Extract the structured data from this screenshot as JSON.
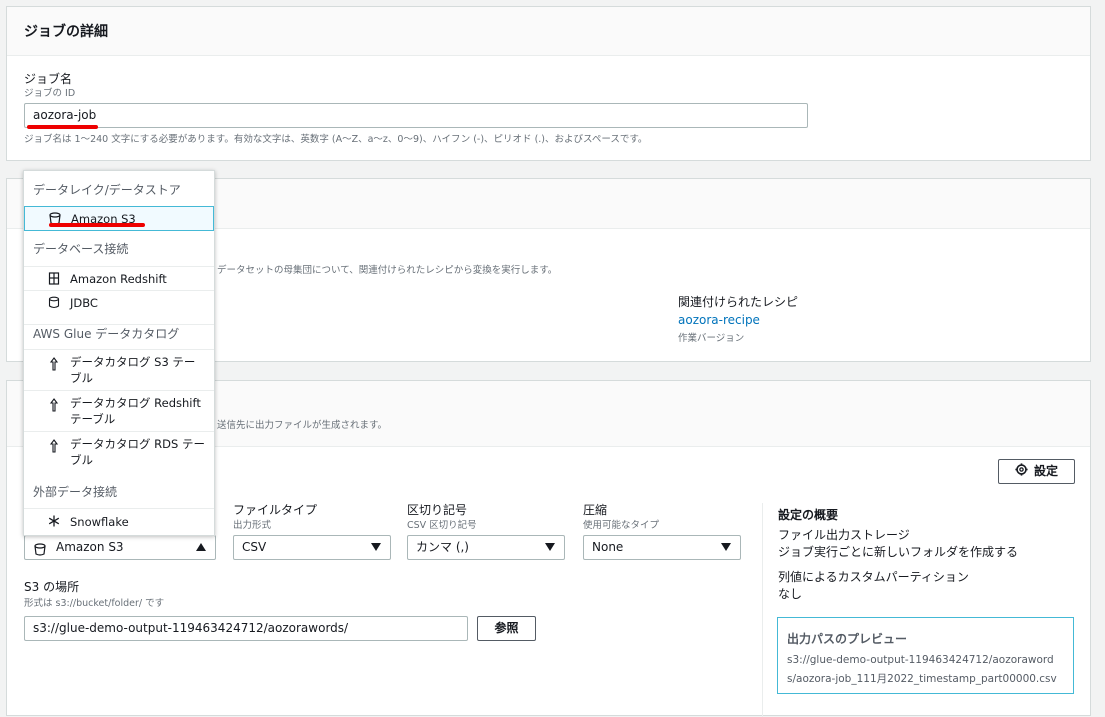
{
  "job_details": {
    "title": "ジョブの詳細",
    "name_label": "ジョブ名",
    "name_sublabel": "ジョブの ID",
    "name_value": "aozora-job",
    "name_hint": "ジョブ名は 1〜240 文字にする必要があります。有効な文字は、英数字 (A〜Z、a〜z、0〜9)、ハイフン (-)、ピリオド (.)、およびスペースです。"
  },
  "recipe_panel": {
    "description": "データセットの母集団について、関連付けられたレシピから変換を実行します。",
    "associated_label": "関連付けられたレシピ",
    "recipe_link": "aozora-recipe",
    "version_label": "作業バージョン"
  },
  "output_panel": {
    "description": "送信先に出力ファイルが生成されます。",
    "settings_button": "設定",
    "file_type_label": "ファイルタイプ",
    "file_type_sub": "出力形式",
    "file_type_value": "CSV",
    "delimiter_label": "区切り記号",
    "delimiter_sub": "CSV 区切り記号",
    "delimiter_value": "カンマ (,)",
    "compression_label": "圧縮",
    "compression_sub": "使用可能なタイプ",
    "compression_value": "None",
    "target_value": "Amazon S3",
    "s3_label": "S3 の場所",
    "s3_sub": "形式は s3://bucket/folder/ です",
    "s3_value": "s3://glue-demo-output-119463424712/aozorawords/",
    "browse_button": "参照"
  },
  "summary": {
    "title": "設定の概要",
    "line1": "ファイル出力ストレージ",
    "line2": "ジョブ実行ごとに新しいフォルダを作成する",
    "line3": "列値によるカスタムパーティション",
    "line4": "なし",
    "preview_title": "出力パスのプレビュー",
    "preview_line1": "s3://glue-demo-output-119463424712/aozoraword",
    "preview_line2": "s/aozora-job_111月2022_timestamp_part00000.csv"
  },
  "dropdown": {
    "group1": "データレイク/データストア",
    "opt_s3": "Amazon S3",
    "group2": "データベース接続",
    "opt_redshift": "Amazon Redshift",
    "opt_jdbc": "JDBC",
    "group3": "AWS Glue データカタログ",
    "opt_cat_s3": "データカタログ S3 テーブル",
    "opt_cat_redshift": "データカタログ Redshift テーブル",
    "opt_cat_rds": "データカタログ RDS テーブル",
    "group4": "外部データ接続",
    "opt_snowflake": "Snowflake"
  },
  "colors": {
    "link": "#0073bb",
    "annotation": "#e00000",
    "highlight_border": "#44b9d6"
  }
}
